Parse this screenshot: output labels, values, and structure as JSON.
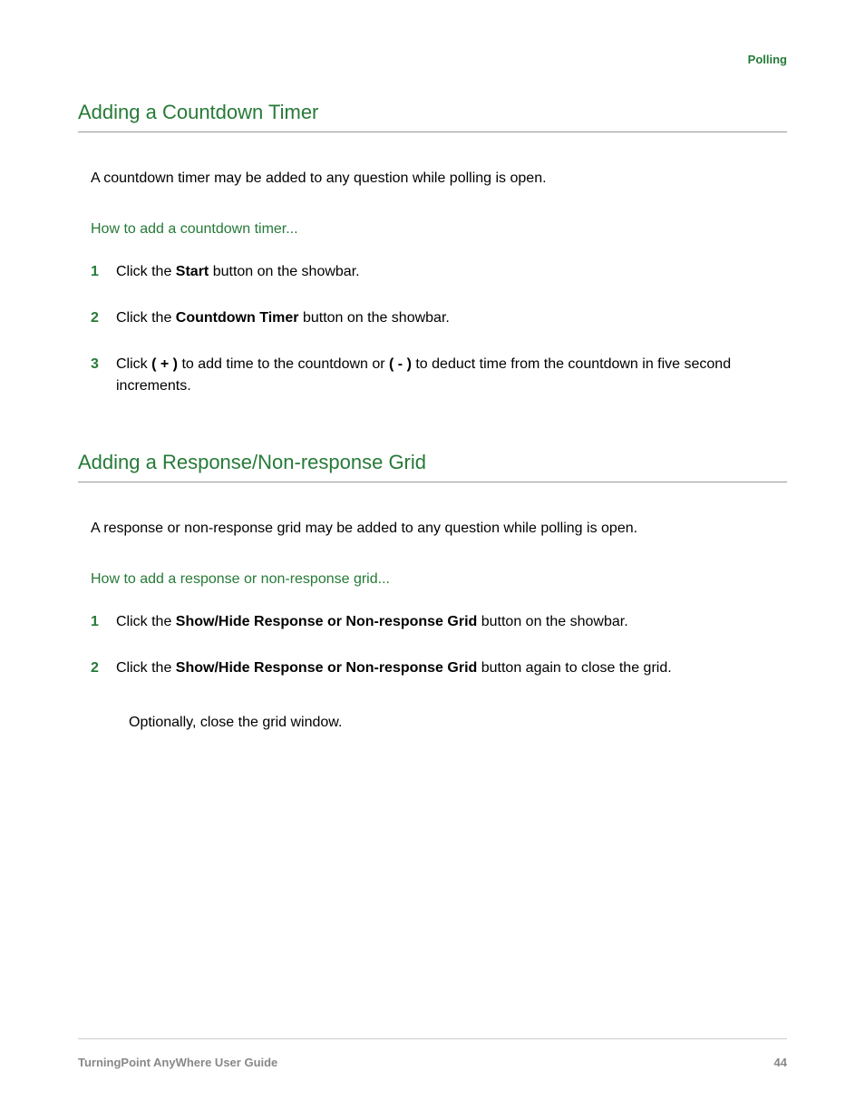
{
  "header": {
    "category": "Polling"
  },
  "section1": {
    "title": "Adding a Countdown Timer",
    "intro": "A countdown timer may be added to any question while polling is open.",
    "subheading": "How to add a countdown timer...",
    "steps": [
      {
        "num": "1",
        "pre": "Click the ",
        "bold": "Start",
        "post": " button on the showbar."
      },
      {
        "num": "2",
        "pre": "Click the ",
        "bold": "Countdown Timer",
        "post": " button on the showbar."
      },
      {
        "num": "3",
        "pre": "Click ",
        "bold": "( + )",
        "mid": " to add time to the countdown or ",
        "bold2": "( - )",
        "post": " to deduct time from the countdown in five second increments."
      }
    ]
  },
  "section2": {
    "title": "Adding a Response/Non-response Grid",
    "intro": "A response or non-response grid may be added to any question while polling is open.",
    "subheading": "How to add a response or non-response grid...",
    "steps": [
      {
        "num": "1",
        "pre": "Click the ",
        "bold": "Show/Hide Response or Non-response Grid",
        "post": " button on the showbar."
      },
      {
        "num": "2",
        "pre": "Click the ",
        "bold": "Show/Hide Response or Non-response Grid",
        "post": " button again to close the grid."
      }
    ],
    "extra": "Optionally, close the grid window."
  },
  "footer": {
    "guide": "TurningPoint AnyWhere User Guide",
    "page": "44"
  }
}
